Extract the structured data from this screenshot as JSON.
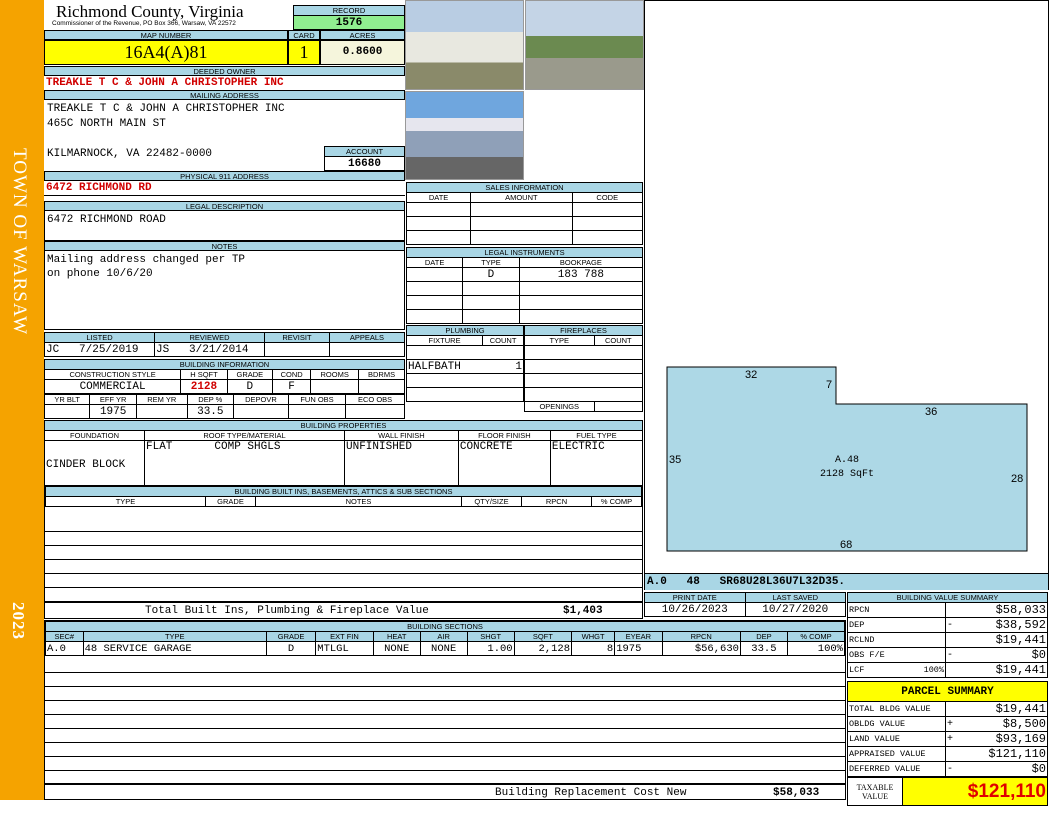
{
  "side": {
    "town": "TOWN OF WARSAW",
    "year": "2023"
  },
  "header": {
    "title": "Richmond County, Virginia",
    "subtitle": "Commissioner of the Revenue, PO Box 366, Warsaw, VA 22572",
    "record_label": "RECORD",
    "record": "1576"
  },
  "map": {
    "map_label": "MAP NUMBER",
    "map_number": "16A4(A)81",
    "card_label": "CARD",
    "card": "1",
    "acres_label": "ACRES",
    "acres": "0.8600"
  },
  "owner": {
    "label": "DEEDED OWNER",
    "value": "TREAKLE T C & JOHN A CHRISTOPHER INC"
  },
  "mailing": {
    "label": "MAILING ADDRESS",
    "line1": "TREAKLE T C & JOHN A CHRISTOPHER INC",
    "line2": "465C NORTH MAIN ST",
    "line3": "KILMARNOCK, VA 22482-0000",
    "account_label": "ACCOUNT",
    "account": "16680"
  },
  "physical": {
    "label": "PHYSICAL 911 ADDRESS",
    "value": "6472 RICHMOND RD"
  },
  "legal": {
    "label": "LEGAL DESCRIPTION",
    "value": "6472 RICHMOND ROAD"
  },
  "notes": {
    "label": "NOTES",
    "value": "Mailing address changed per TP\non phone 10/6/20"
  },
  "sales": {
    "label": "SALES INFORMATION",
    "cols": [
      "DATE",
      "AMOUNT",
      "CODE"
    ]
  },
  "instruments": {
    "label": "LEGAL INSTRUMENTS",
    "cols": [
      "DATE",
      "TYPE",
      "BOOKPAGE"
    ],
    "row": {
      "date": "",
      "type": "D",
      "bookpage": "183 788"
    }
  },
  "listed": {
    "cols": [
      "LISTED",
      "REVIEWED",
      "REVISIT",
      "APPEALS"
    ],
    "listed_by": "JC",
    "listed_date": "7/25/2019",
    "reviewed_by": "JS",
    "reviewed_date": "3/21/2014"
  },
  "building_info": {
    "label": "BUILDING INFORMATION",
    "cols1": [
      "CONSTRUCTION STYLE",
      "H SQFT",
      "GRADE",
      "COND",
      "ROOMS",
      "BDRMS"
    ],
    "vals1": [
      "COMMERCIAL",
      "2128",
      "D",
      "F",
      "",
      ""
    ],
    "cols2": [
      "YR BLT",
      "EFF YR",
      "REM YR",
      "DEP %",
      "DEPOVR",
      "FUN OBS",
      "ECO OBS"
    ],
    "vals2": [
      "",
      "1975",
      "",
      "33.5",
      "",
      "",
      ""
    ]
  },
  "plumbing": {
    "label": "PLUMBING",
    "cols": [
      "FIXTURE",
      "COUNT"
    ],
    "fixture": "HALFBATH",
    "count": "1"
  },
  "fireplaces": {
    "label": "FIREPLACES",
    "cols": [
      "TYPE",
      "COUNT"
    ],
    "openings": "OPENINGS"
  },
  "properties": {
    "label": "BUILDING PROPERTIES",
    "cols": [
      "FOUNDATION",
      "ROOF TYPE/MATERIAL",
      "WALL FINISH",
      "FLOOR FINISH",
      "FUEL TYPE"
    ],
    "foundation": "CINDER BLOCK",
    "roof_type": "FLAT",
    "roof_material": "COMP SHGLS",
    "wall": "UNFINISHED",
    "floor": "CONCRETE",
    "fuel": "ELECTRIC"
  },
  "builtins": {
    "label": "BUILDING BUILT INS, BASEMENTS, ATTICS & SUB SECTIONS",
    "cols": [
      "TYPE",
      "GRADE",
      "NOTES",
      "QTY/SIZE",
      "RPCN",
      "% COMP"
    ],
    "total_label": "Total Built Ins, Plumbing & Fireplace Value",
    "total": "$1,403"
  },
  "sketch": {
    "area_label": "A.48",
    "sqft": "2128 SqFt",
    "dims": [
      "32",
      "7",
      "36",
      "35",
      "28",
      "68"
    ],
    "code": "A.0   48   SR68U28L36U7L32D35.",
    "fill": "#add8e6"
  },
  "dates": {
    "print_label": "PRINT DATE",
    "print": "10/26/2023",
    "saved_label": "LAST SAVED",
    "saved": "10/27/2020"
  },
  "sections": {
    "label": "BUILDING SECTIONS",
    "cols": [
      "SEC#",
      "TYPE",
      "GRADE",
      "EXT FIN",
      "HEAT",
      "AIR",
      "SHGT",
      "SQFT",
      "WHGT",
      "EYEAR",
      "RPCN",
      "DEP",
      "% COMP"
    ],
    "row": [
      "A.0",
      "48 SERVICE GARAGE",
      "D",
      "MTLGL",
      "NONE",
      "NONE",
      "1.00",
      "2,128",
      "8",
      "1975",
      "$56,630",
      "33.5",
      "100%"
    ],
    "total_label": "Building Replacement Cost New",
    "total": "$58,033"
  },
  "value_summary": {
    "label": "BUILDING VALUE SUMMARY",
    "rows": [
      {
        "k": "RPCN",
        "s": "",
        "v": "$58,033"
      },
      {
        "k": "DEP",
        "s": "-",
        "v": "$38,592"
      },
      {
        "k": "RCLND",
        "s": "",
        "v": "$19,441"
      },
      {
        "k": "OBS F/E",
        "s": "-",
        "v": "$0"
      },
      {
        "k": "LCF",
        "p": "100%",
        "s": "",
        "v": "$19,441"
      }
    ]
  },
  "parcel": {
    "label": "PARCEL SUMMARY",
    "rows": [
      {
        "k": "TOTAL BLDG VALUE",
        "s": "",
        "v": "$19,441"
      },
      {
        "k": "OBLDG VALUE",
        "s": "+",
        "v": "$8,500"
      },
      {
        "k": "LAND VALUE",
        "s": "+",
        "v": "$93,169"
      },
      {
        "k": "APPRAISED VALUE",
        "s": "",
        "v": "$121,110"
      },
      {
        "k": "DEFERRED VALUE",
        "s": "-",
        "v": "$0"
      }
    ],
    "taxable_label": "TAXABLE VALUE",
    "taxable": "$121,110"
  }
}
